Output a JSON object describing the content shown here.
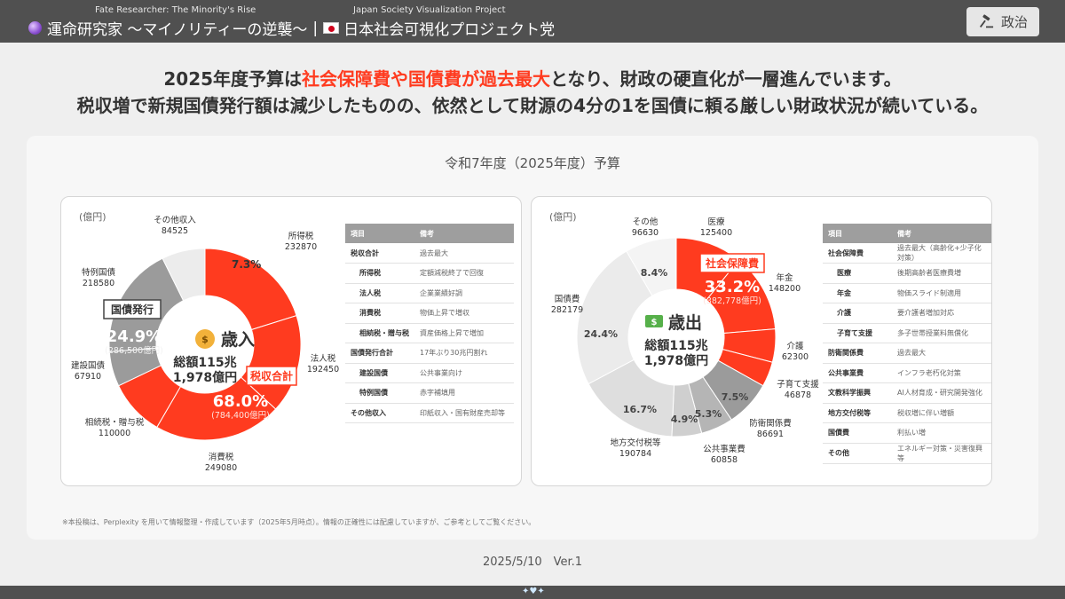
{
  "header": {
    "left_sub": "Fate Researcher: The Minority's Rise",
    "left_title": "運命研究家 〜マイノリティーの逆襲〜",
    "separator": "|",
    "right_sub": "Japan Society Visualization Project",
    "right_title": "日本社会可視化プロジェクト党",
    "tag_label": "政治",
    "crystal_icon": "crystal-ball-icon",
    "flag_icon": "japan-flag-icon",
    "tag_icon": "gavel-icon"
  },
  "headline": {
    "line1_pre": "2025年度予算は",
    "line1_hl": "社会保障費や国債費が過去最大",
    "line1_post": "となり、財政の硬直化が一層進んでいます。",
    "line2": "税収増で新規国債発行額は減少したものの、依然として財源の4分の1を国債に頼る厳しい財政状況が続いている。"
  },
  "panel_title": "令和7年度（2025年度）予算",
  "colors": {
    "accent": "#ff3b1f",
    "gray_dark": "#9b9b9b",
    "gray_light": "#d9d9d9"
  },
  "revenue": {
    "unit": "(億円)",
    "center_icon": "money-bag-icon",
    "center_title": "歳入",
    "total_line1": "総額115兆",
    "total_line2": "1,978億円",
    "tax_callout_label": "税収合計",
    "tax_callout_pct": "68.0%",
    "tax_callout_amt": "(784,400億円)",
    "bond_callout_label": "国債発行",
    "bond_callout_pct": "24.9%",
    "bond_callout_amt": "(286,500億円)",
    "other_pct": "7.3%",
    "table": {
      "headers": [
        "項目",
        "備考"
      ],
      "rows": [
        {
          "k": "税収合計",
          "v": "過去最大",
          "sub": false
        },
        {
          "k": "所得税",
          "v": "定額減税終了で回復",
          "sub": true
        },
        {
          "k": "法人税",
          "v": "企業業績好調",
          "sub": true
        },
        {
          "k": "消費税",
          "v": "物価上昇で増収",
          "sub": true
        },
        {
          "k": "相続税・贈与税",
          "v": "資産価格上昇で増加",
          "sub": true
        },
        {
          "k": "国債発行合計",
          "v": "17年ぶり30兆円割れ",
          "sub": false
        },
        {
          "k": "建設国債",
          "v": "公共事業向け",
          "sub": true
        },
        {
          "k": "特例国債",
          "v": "赤字補填用",
          "sub": true
        },
        {
          "k": "その他収入",
          "v": "印紙収入・国有財産売却等",
          "sub": false
        }
      ]
    }
  },
  "expenditure": {
    "unit": "(億円)",
    "center_icon": "money-with-wings-icon",
    "center_title": "歳出",
    "total_line1": "総額115兆",
    "total_line2": "1,978億円",
    "social_callout_label": "社会保障費",
    "social_callout_pct": "33.2%",
    "social_callout_amt": "(382,778億円)",
    "table": {
      "headers": [
        "項目",
        "備考"
      ],
      "rows": [
        {
          "k": "社会保障費",
          "v": "過去最大（高齢化+少子化対策）",
          "sub": false
        },
        {
          "k": "医療",
          "v": "後期高齢者医療費増",
          "sub": true
        },
        {
          "k": "年金",
          "v": "物価スライド制適用",
          "sub": true
        },
        {
          "k": "介護",
          "v": "要介護者増加対応",
          "sub": true
        },
        {
          "k": "子育て支援",
          "v": "多子世帯授業料無償化",
          "sub": true
        },
        {
          "k": "防衛関係費",
          "v": "過去最大",
          "sub": false
        },
        {
          "k": "公共事業費",
          "v": "インフラ老朽化対策",
          "sub": false
        },
        {
          "k": "文教科学振興",
          "v": "AI人材育成・研究開発強化",
          "sub": false
        },
        {
          "k": "地方交付税等",
          "v": "税収増に伴い増額",
          "sub": false
        },
        {
          "k": "国債費",
          "v": "利払い増",
          "sub": false
        },
        {
          "k": "その他",
          "v": "エネルギー対策・災害復興等",
          "sub": false
        }
      ]
    }
  },
  "chart_data": [
    {
      "type": "pie",
      "title": "歳入",
      "unit": "億円",
      "slices": [
        {
          "name": "所得税",
          "value": 232870,
          "color": "#ff3b1f"
        },
        {
          "name": "法人税",
          "value": 192450,
          "color": "#ff3b1f"
        },
        {
          "name": "消費税",
          "value": 249080,
          "color": "#ff3b1f"
        },
        {
          "name": "相続税・贈与税",
          "value": 110000,
          "color": "#ff3b1f"
        },
        {
          "name": "建設国債",
          "value": 67910,
          "color": "#9b9b9b"
        },
        {
          "name": "特例国債",
          "value": 218580,
          "color": "#9b9b9b"
        },
        {
          "name": "その他収入",
          "value": 84525,
          "color": "#ececec"
        }
      ],
      "ext_labels": [
        {
          "name": "所得税",
          "value": "232870"
        },
        {
          "name": "法人税",
          "value": "192450"
        },
        {
          "name": "消費税",
          "value": "249080"
        },
        {
          "name": "相続税・贈与税",
          "value": "110000"
        },
        {
          "name": "建設国債",
          "value": "67910"
        },
        {
          "name": "特例国債",
          "value": "218580"
        },
        {
          "name": "その他収入",
          "value": "84525"
        }
      ]
    },
    {
      "type": "pie",
      "title": "歳出",
      "unit": "億円",
      "slices": [
        {
          "name": "医療",
          "value": 125400,
          "color": "#ff3b1f"
        },
        {
          "name": "年金",
          "value": 148200,
          "color": "#ff3b1f"
        },
        {
          "name": "介護",
          "value": 62300,
          "color": "#ff3b1f"
        },
        {
          "name": "子育て支援",
          "value": 46878,
          "color": "#ff3b1f"
        },
        {
          "name": "防衛関係費",
          "value": 86691,
          "color": "#9b9b9b",
          "pct": "7.5%"
        },
        {
          "name": "公共事業費",
          "value": 60858,
          "color": "#b5b5b5",
          "pct": "5.3%"
        },
        {
          "name": "文教科学振興",
          "value": 56000,
          "color": "#cfcfcf",
          "pct": "4.9%"
        },
        {
          "name": "地方交付税等",
          "value": 190784,
          "color": "#dedede",
          "pct": "16.7%"
        },
        {
          "name": "国債費",
          "value": 282179,
          "color": "#ebebeb",
          "pct": "24.4%"
        },
        {
          "name": "その他",
          "value": 96630,
          "color": "#f4f4f4",
          "pct": "8.4%"
        }
      ],
      "ext_labels": [
        {
          "name": "医療",
          "value": "125400"
        },
        {
          "name": "年金",
          "value": "148200"
        },
        {
          "name": "介護",
          "value": "62300"
        },
        {
          "name": "子育て支援",
          "value": "46878"
        },
        {
          "name": "防衛関係費",
          "value": "86691"
        },
        {
          "name": "公共事業費",
          "value": "60858"
        },
        {
          "name": "地方交付税等",
          "value": "190784"
        },
        {
          "name": "国債費",
          "value": "282179"
        },
        {
          "name": "その他",
          "value": "96630"
        }
      ]
    }
  ],
  "footnote": "※本投稿は、Perplexity を用いて情報整理・作成しています（2025年5月時点）。情報の正確性には配慮していますが、ご参考としてご覧ください。",
  "date": "2025/5/10　Ver.1",
  "bottom_icon": "sparkle-heart-icon",
  "bottom_glyph": "✦♥✦"
}
